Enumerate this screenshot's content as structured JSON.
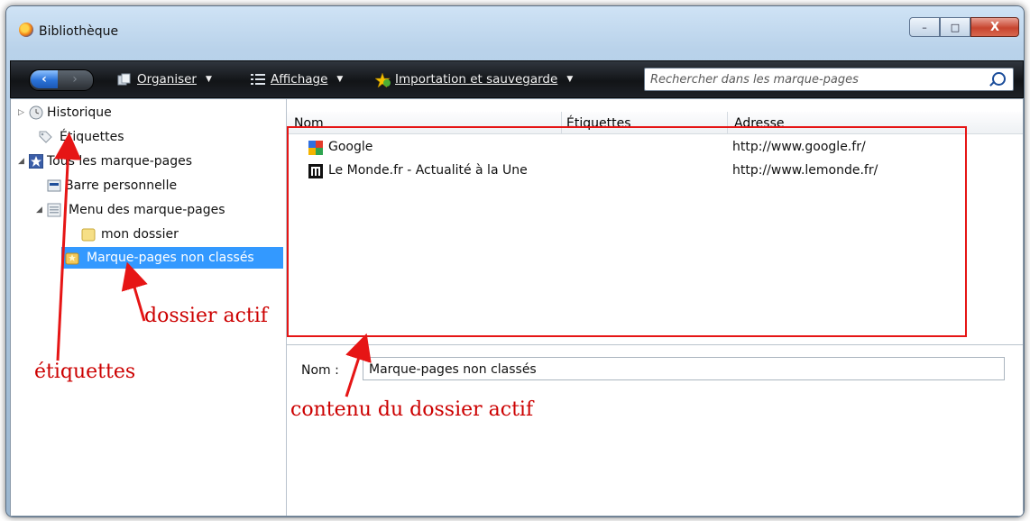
{
  "window": {
    "title": "Bibliothèque",
    "controls": {
      "minimize": "–",
      "maximize": "□",
      "close": "X"
    }
  },
  "toolbar": {
    "back": "‹",
    "forward": "›",
    "organiser": "Organiser",
    "affichage": "Affichage",
    "importation": "Importation et sauvegarde",
    "search_placeholder": "Rechercher dans les marque-pages"
  },
  "sidebar": {
    "items": [
      {
        "label": "Historique",
        "icon": "clock-icon"
      },
      {
        "label": "Étiquettes",
        "icon": "tag-icon"
      },
      {
        "label": "Tous les marque-pages",
        "icon": "star-icon"
      },
      {
        "label": "Barre personnelle",
        "icon": "toolbar-folder-icon"
      },
      {
        "label": "Menu des marque-pages",
        "icon": "menu-folder-icon"
      },
      {
        "label": "mon dossier",
        "icon": "folder-icon"
      },
      {
        "label": "Marque-pages non classés",
        "icon": "unsorted-folder-icon",
        "selected": true
      }
    ]
  },
  "table": {
    "columns": [
      "Nom",
      "Étiquettes",
      "Adresse"
    ],
    "rows": [
      {
        "name": "Google",
        "tags": "",
        "url": "http://www.google.fr/",
        "icon": "google-favicon"
      },
      {
        "name": "Le Monde.fr - Actualité à la Une",
        "tags": "",
        "url": "http://www.lemonde.fr/",
        "icon": "lemonde-favicon"
      }
    ]
  },
  "details": {
    "nom_label": "Nom :",
    "nom_value": "Marque-pages non classés"
  },
  "annotations": {
    "etiquettes": "étiquettes",
    "dossier_actif": "dossier actif",
    "contenu": "contenu du dossier actif",
    "color": "#cc0000"
  }
}
